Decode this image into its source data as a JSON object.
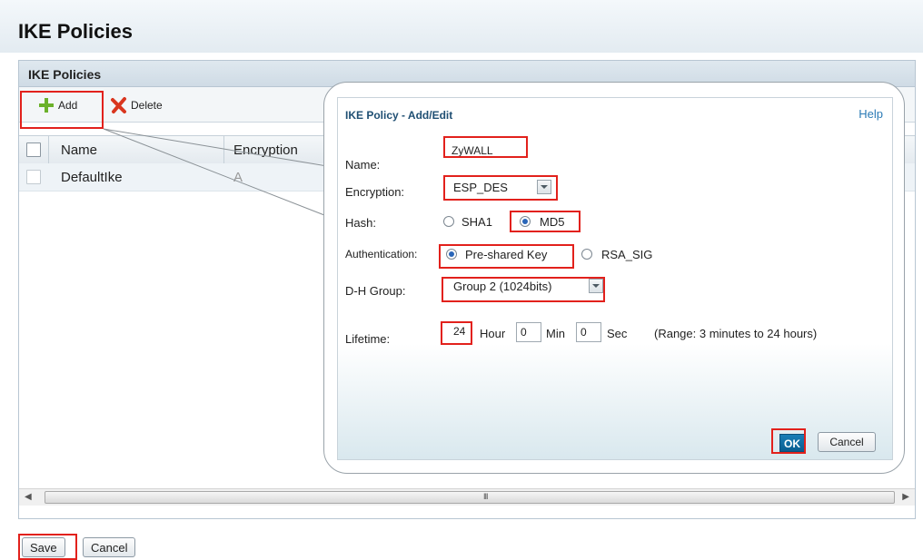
{
  "page": {
    "title": "IKE Policies"
  },
  "panel": {
    "header": "IKE Policies"
  },
  "toolbar": {
    "add_label": "Add",
    "delete_label": "Delete"
  },
  "grid": {
    "columns": [
      "Name",
      "Encryption"
    ],
    "rows": [
      {
        "name": "DefaultIke",
        "encryption": "A"
      }
    ]
  },
  "scrollbar": {
    "grip": "III"
  },
  "footer": {
    "save_label": "Save",
    "cancel_label": "Cancel"
  },
  "dialog": {
    "title": "IKE Policy - Add/Edit",
    "help": "Help",
    "name_label": "Name:",
    "name_value": "ZyWALL",
    "encryption_label": "Encryption:",
    "encryption_value": "ESP_DES",
    "hash_label": "Hash:",
    "hash_options": [
      "SHA1",
      "MD5"
    ],
    "hash_selected": "MD5",
    "auth_label": "Authentication:",
    "auth_options": [
      "Pre-shared Key",
      "RSA_SIG"
    ],
    "auth_selected": "Pre-shared Key",
    "dh_label": "D-H Group:",
    "dh_value": "Group 2 (1024bits)",
    "lifetime_label": "Lifetime:",
    "lifetime_hour": "24",
    "hour_unit": "Hour",
    "lifetime_min": "0",
    "min_unit": "Min",
    "lifetime_sec": "0",
    "sec_unit": "Sec",
    "range_note": "(Range: 3 minutes to 24 hours)",
    "ok_label": "OK",
    "cancel_label": "Cancel"
  },
  "colors": {
    "highlight": "#e2211c",
    "accent": "#1a7db6"
  }
}
